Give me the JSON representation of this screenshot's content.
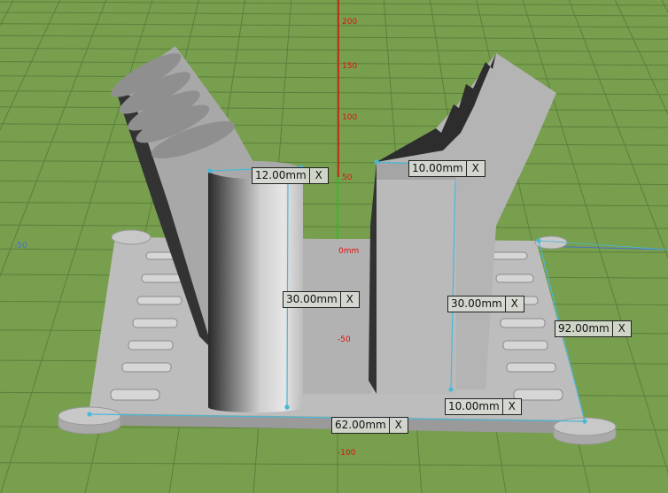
{
  "axis": {
    "z_ticks": [
      "200",
      "150",
      "100",
      "50",
      "0mm",
      "-50",
      "-100"
    ],
    "x_tick": "-50"
  },
  "dimensions": [
    {
      "value": "12.00mm",
      "close": "X"
    },
    {
      "value": "10.00mm",
      "close": "X"
    },
    {
      "value": "30.00mm",
      "close": "X"
    },
    {
      "value": "30.00mm",
      "close": "X"
    },
    {
      "value": "92.00mm",
      "close": "X"
    },
    {
      "value": "10.00mm",
      "close": "X"
    },
    {
      "value": "62.00mm",
      "close": "X"
    }
  ],
  "colors": {
    "ground": "#779f4e",
    "grid": "#5d7f3c",
    "model": "#b8b8b8",
    "measure": "#4ab8d8",
    "axis_z": "#e01010",
    "axis_y": "#20c020"
  }
}
